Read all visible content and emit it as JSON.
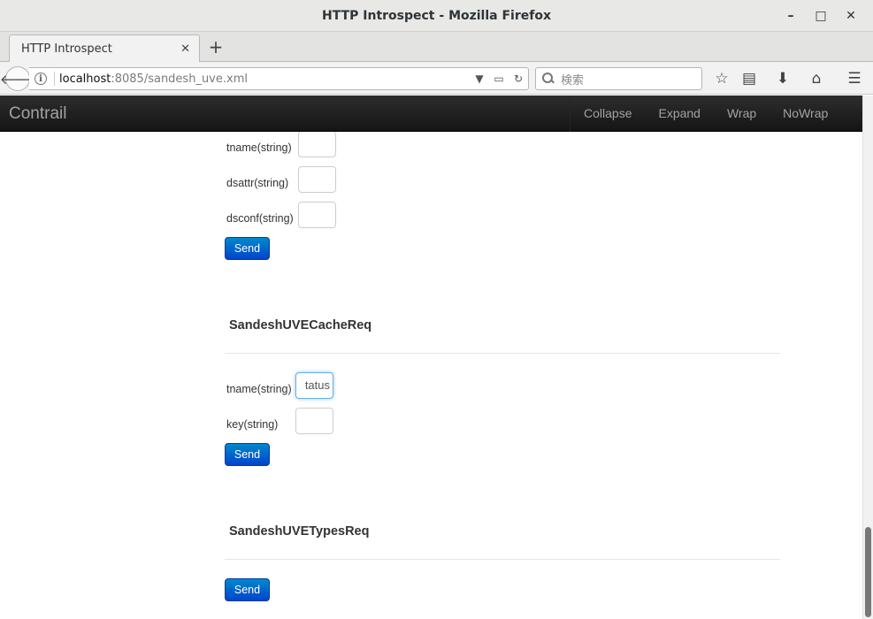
{
  "window": {
    "title": "HTTP Introspect - Mozilla Firefox",
    "minimize": "–",
    "maximize": "□",
    "close": "✕"
  },
  "tabs": [
    {
      "label": "HTTP Introspect",
      "close": "✕"
    }
  ],
  "new_tab_label": "+",
  "navbar": {
    "url_host": "localhost",
    "url_rest": ":8085/sandesh_uve.xml",
    "search_placeholder": "検索"
  },
  "app": {
    "brand": "Contrail",
    "menu": [
      "Collapse",
      "Expand",
      "Wrap",
      "NoWrap"
    ]
  },
  "forms": {
    "top_partial": {
      "fields": [
        {
          "label": "tname(string)",
          "value": ""
        },
        {
          "label": "dsattr(string)",
          "value": ""
        },
        {
          "label": "dsconf(string)",
          "value": ""
        }
      ],
      "send": "Send"
    },
    "cache_req": {
      "title": "SandeshUVECacheReq",
      "fields": [
        {
          "label": "tname(string)",
          "value": "tatus"
        },
        {
          "label": "key(string)",
          "value": ""
        }
      ],
      "send": "Send"
    },
    "types_req": {
      "title": "SandeshUVETypesReq",
      "send": "Send"
    }
  },
  "colors": {
    "accent": "#0066cc",
    "header_bg": "#1b1b1b",
    "header_text": "#a2a2a2"
  }
}
